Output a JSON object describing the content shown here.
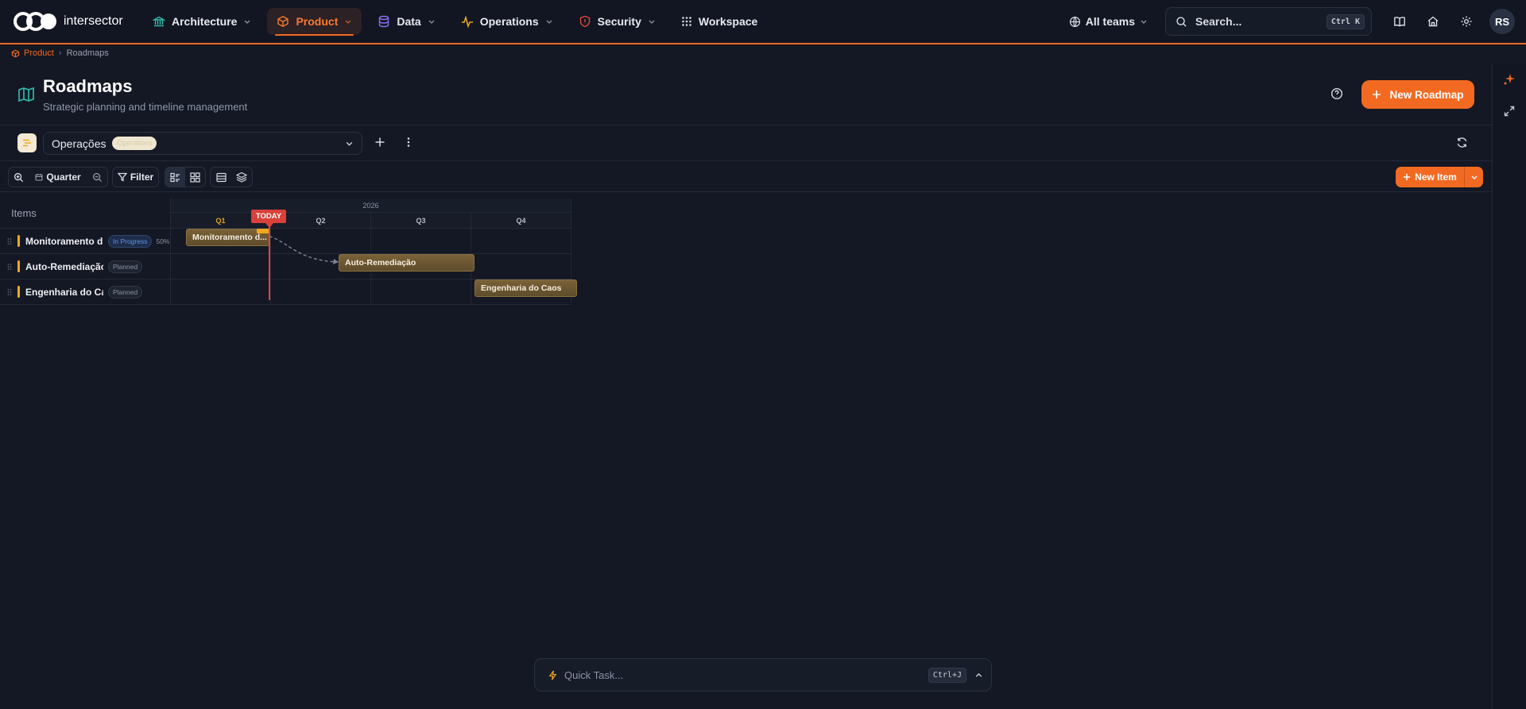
{
  "brand": {
    "name": "intersector"
  },
  "nav": {
    "items": [
      {
        "label": "Architecture",
        "icon": "bank-icon",
        "color": "#2fc0b0"
      },
      {
        "label": "Product",
        "icon": "box-icon",
        "color": "#f97a2e",
        "active": true
      },
      {
        "label": "Data",
        "icon": "database-icon",
        "color": "#8b6ff0"
      },
      {
        "label": "Operations",
        "icon": "pulse-icon",
        "color": "#f0a81e"
      },
      {
        "label": "Security",
        "icon": "shield-icon",
        "color": "#e2463f"
      },
      {
        "label": "Workspace",
        "icon": "grid-icon",
        "color": "#d8dbe3"
      }
    ],
    "teams_label": "All teams",
    "search_placeholder": "Search...",
    "search_shortcut": "Ctrl K",
    "avatar_initials": "RS"
  },
  "breadcrumb": {
    "root": "Product",
    "current": "Roadmaps"
  },
  "header": {
    "title": "Roadmaps",
    "subtitle": "Strategic planning and timeline management",
    "new_button": "New Roadmap"
  },
  "selector": {
    "name": "Operações",
    "badge": "Operations"
  },
  "toolbar": {
    "zoom_label": "Quarter",
    "filter_label": "Filter",
    "new_item_label": "New Item"
  },
  "gantt": {
    "items_header": "Items",
    "year": "2026",
    "quarters": [
      "Q1",
      "Q2",
      "Q3",
      "Q4"
    ],
    "current_quarter": "Q1",
    "today_label": "TODAY",
    "items": [
      {
        "name": "Monitoramento d...",
        "bar_label": "Monitoramento d...",
        "status": "In Progress",
        "progress": "50%"
      },
      {
        "name": "Auto-Remediação",
        "bar_label": "Auto-Remediação",
        "status": "Planned"
      },
      {
        "name": "Engenharia do Caos",
        "bar_label": "Engenharia do Caos",
        "status": "Planned"
      }
    ]
  },
  "quick_task": {
    "placeholder": "Quick Task...",
    "shortcut": "Ctrl+J"
  },
  "colors": {
    "accent": "#f26a22",
    "bar": "#6e5833",
    "today": "#e2463f",
    "status_in_progress": "#5b95f0"
  }
}
